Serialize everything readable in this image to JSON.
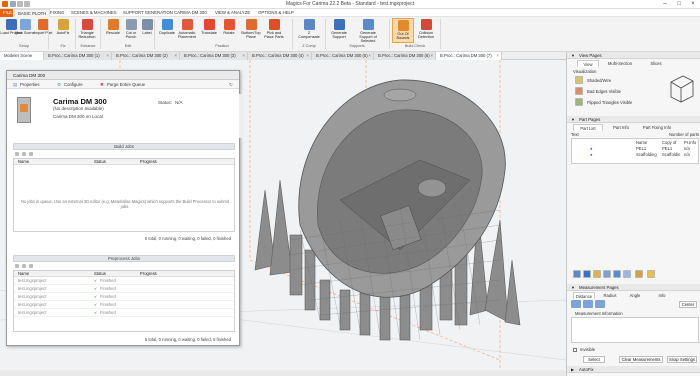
{
  "app": {
    "title": "Magics For Carima 22.2 Beta - Standard - test.mgxproject"
  },
  "ribbon_tabs": [
    "FILE",
    "BASIC PLOTH",
    "FIXING",
    "SCENES & MACHINES",
    "SUPPORT GENERATION",
    "CARIMA DM 300",
    "VIEW & ANALYZE",
    "OPTIONS & HELP"
  ],
  "ribbon": {
    "buttons": [
      {
        "label": "Load Project",
        "icon": "load-project-icon"
      },
      {
        "label": "New Scene",
        "icon": "new-scene-icon"
      },
      {
        "label": "Import Part",
        "icon": "import-part-icon"
      },
      {
        "label": "AutoFix",
        "icon": "autofix-icon"
      },
      {
        "label": "Triangle Reduction",
        "icon": "triangle-reduction-icon"
      },
      {
        "label": "Rescale",
        "icon": "rescale-icon"
      },
      {
        "label": "Cut or Punch",
        "icon": "cut-icon"
      },
      {
        "label": "Label",
        "icon": "label-icon"
      },
      {
        "label": "Duplicate",
        "icon": "duplicate-icon"
      },
      {
        "label": "Automatic Placement",
        "icon": "placement-icon"
      },
      {
        "label": "Translate",
        "icon": "translate-icon"
      },
      {
        "label": "Rotate",
        "icon": "rotate-icon"
      },
      {
        "label": "Bottom/Top Plane",
        "icon": "plane-icon"
      },
      {
        "label": "Pick and Place Parts",
        "icon": "pick-place-icon"
      },
      {
        "label": "Z Compensate",
        "icon": "z-compensate-icon"
      },
      {
        "label": "Generate Support",
        "icon": "support-icon"
      },
      {
        "label": "Generate Support of Selected",
        "icon": "support-selected-icon"
      },
      {
        "label": "Out Of Bounds",
        "icon": "out-of-bounds-icon"
      },
      {
        "label": "Collision Detection",
        "icon": "collision-icon"
      }
    ],
    "groups": [
      "Setup",
      "Fix",
      "Enhance",
      "Edit",
      "Position",
      "Z Comp",
      "Supports",
      "Build Check"
    ]
  },
  "doc_tabs": [
    "Modeler Scene",
    "B.Proc.: Carima DM 300 (1)",
    "B.Proc.: Carima DM 300 (2)",
    "B.Proc.: Carima DM 300 (3)",
    "B.Proc.: Carima DM 300 (4)",
    "B.Proc.: Carima DM 300 (5)",
    "B.Proc.: Carima DM 300 (6)",
    "B.Proc.: Carima DM 300 (7)"
  ],
  "dialog": {
    "title": "Carima DM 300",
    "toolbar": {
      "properties": "Properties",
      "configure": "Configure",
      "purge": "Purge Entire Queue"
    },
    "machine": {
      "name": "Carima DM 300",
      "description": "(No description available)",
      "location": "Carima DM 300 on Local",
      "status_label": "Status:",
      "status_value": "N/A"
    },
    "build_jobs": {
      "header": "Build Jobs",
      "columns": [
        "Name",
        "Status",
        "Progress"
      ],
      "empty_text": "No jobs in queue. Use an external 3D editor (e.g. Materialise Magics) which supports the Build Processor to submit jobs.",
      "summary": "0 total, 0 running, 0 waiting, 0 failed, 0 finished"
    },
    "preprocess_jobs": {
      "header": "Preprocess Jobs",
      "columns": [
        "Name",
        "Status",
        "Progress"
      ],
      "rows": [
        {
          "name": "test.mgxproject",
          "status": "Finished"
        },
        {
          "name": "test.mgxproject",
          "status": "Finished"
        },
        {
          "name": "test.mgxproject",
          "status": "Finished"
        },
        {
          "name": "test.mgxproject",
          "status": "Finished"
        },
        {
          "name": "test.mgxproject",
          "status": "Finished"
        }
      ],
      "summary": "5 total, 0 running, 0 waiting, 0 failed, 5 finished"
    }
  },
  "right_panel": {
    "view_pages": {
      "header": "View Pages",
      "tabs": [
        "View",
        "Multi-Section",
        "Slices"
      ],
      "visualization_label": "Visualization",
      "options": [
        "Shaded/Wire",
        "Bad Edges Visible",
        "Flipped Triangles Visible"
      ]
    },
    "part_pages": {
      "header": "Part Pages",
      "tabs": [
        "Part List",
        "Part Info",
        "Part Fixing Info"
      ],
      "text_label": "Text",
      "count_label": "Number of parts",
      "columns": [
        "Name",
        "Copy of",
        "Pr.Info"
      ],
      "rows": [
        {
          "name": "PEL1",
          "copy": "PEL1",
          "info": "n/a"
        },
        {
          "name": "Scaffolding",
          "copy": "Scaffoldin",
          "info": "n/a"
        }
      ]
    },
    "measurement_pages": {
      "header": "Measurement Pages",
      "tabs": [
        "Distance",
        "Radius",
        "Angle",
        "Info"
      ],
      "info_label": "Measurement Information",
      "center_label": "Center",
      "invisible_label": "Invisible",
      "buttons": [
        "Select",
        "Clear Measurements",
        "Snap Settings"
      ]
    },
    "autofix_label": "AutoFix"
  },
  "colors": {
    "accent": "#e8630a",
    "panel_header": "#e3e5e8",
    "viewport_bg": "#f1f2f4",
    "model_grey": "#8c8c8c"
  }
}
